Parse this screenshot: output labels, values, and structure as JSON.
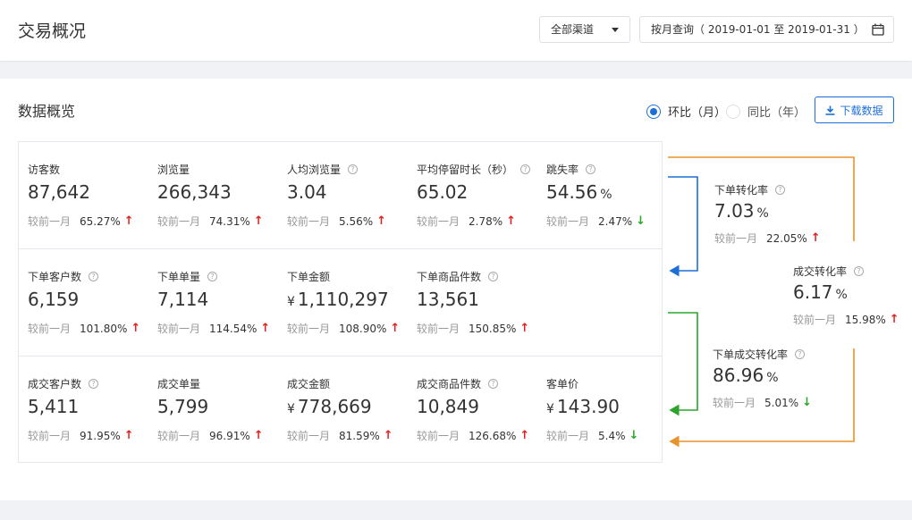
{
  "header": {
    "title": "交易概况",
    "channel": "全部渠道",
    "date_range": "按月查询（ 2019-01-01 至 2019-01-31 ）"
  },
  "panel": {
    "title": "数据概览",
    "radio_mom": "环比（月）",
    "radio_yoy": "同比（年）",
    "download": "下载数据"
  },
  "compare_label": "较前一月",
  "currency": "¥",
  "colors": {
    "primary": "#1d6fd8",
    "up": "#e02020",
    "down": "#2aa52a",
    "blue_flow": "#1d6fd8",
    "green_flow": "#2aa52a",
    "orange_flow": "#e8922a"
  },
  "row0": [
    {
      "label": "访客数",
      "value": "87,642",
      "change": "65.27%",
      "dir": "up"
    },
    {
      "label": "浏览量",
      "value": "266,343",
      "change": "74.31%",
      "dir": "up"
    },
    {
      "label": "人均浏览量",
      "value": "3.04",
      "change": "5.56%",
      "dir": "up"
    },
    {
      "label": "平均停留时长（秒）",
      "value": "65.02",
      "change": "2.78%",
      "dir": "up"
    },
    {
      "label": "跳失率",
      "value": "54.56",
      "unit": "%",
      "change": "2.47%",
      "dir": "down"
    }
  ],
  "row1": [
    {
      "label": "下单客户数",
      "value": "6,159",
      "change": "101.80%",
      "dir": "up"
    },
    {
      "label": "下单单量",
      "value": "7,114",
      "change": "114.54%",
      "dir": "up"
    },
    {
      "label": "下单金额",
      "value": "1,110,297",
      "change": "108.90%",
      "dir": "up"
    },
    {
      "label": "下单商品件数",
      "value": "13,561",
      "change": "150.85%",
      "dir": "up"
    }
  ],
  "row2": [
    {
      "label": "成交客户数",
      "value": "5,411",
      "change": "91.95%",
      "dir": "up"
    },
    {
      "label": "成交单量",
      "value": "5,799",
      "change": "96.91%",
      "dir": "up"
    },
    {
      "label": "成交金额",
      "value": "778,669",
      "change": "81.59%",
      "dir": "up"
    },
    {
      "label": "成交商品件数",
      "value": "10,849",
      "change": "126.68%",
      "dir": "up"
    },
    {
      "label": "客单价",
      "value": "143.90",
      "change": "5.4%",
      "dir": "down"
    }
  ],
  "side": {
    "order_conv": {
      "label": "下单转化率",
      "value": "7.03",
      "unit": "%",
      "change": "22.05%",
      "dir": "up"
    },
    "deal_conv": {
      "label": "成交转化率",
      "value": "6.17",
      "unit": "%",
      "change": "15.98%",
      "dir": "up"
    },
    "order_deal_conv": {
      "label": "下单成交转化率",
      "value": "86.96",
      "unit": "%",
      "change": "5.01%",
      "dir": "down"
    }
  },
  "arrow_glyphs": {
    "up": "↑",
    "down": "↓"
  }
}
